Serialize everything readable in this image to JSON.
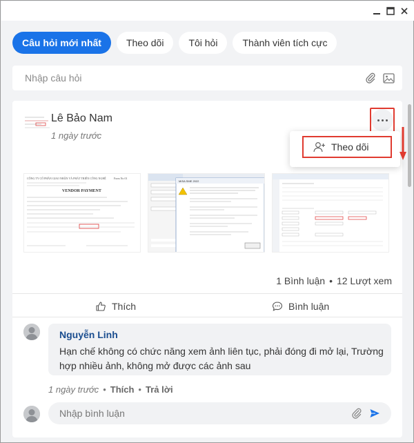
{
  "tabs": [
    {
      "label": "Câu hỏi mới nhất",
      "active": true
    },
    {
      "label": "Theo dõi",
      "active": false
    },
    {
      "label": "Tôi hỏi",
      "active": false
    },
    {
      "label": "Thành viên tích cực",
      "active": false
    }
  ],
  "ask": {
    "placeholder": "Nhập câu hỏi"
  },
  "post": {
    "author": "Lê Bảo Nam",
    "time": "1 ngày trước",
    "menu": {
      "follow_label": "Theo dõi"
    },
    "stats": {
      "comments": "1 Bình luận",
      "separator": "•",
      "views": "12 Lượt xem"
    },
    "actions": {
      "like": "Thích",
      "comment": "Bình luận"
    },
    "image1": {
      "header1": "CÔNG TY CỔ PHẦN GIAO NHẬN VÀ PHÁT TRIỂN CÔNG NGHỆ",
      "title": "VENDOR PAYMENT",
      "form_no": "Form No 01"
    },
    "image2": {
      "title": "MISA SME 2022"
    },
    "image3": {}
  },
  "comment": {
    "author": "Nguyễn Linh",
    "text": "Hạn chế không có chức năng xem ảnh liên tục, phải đóng đi mở lại, Trường hợp nhiều ảnh, không mở được các ảnh sau",
    "time": "1 ngày trước",
    "separator": "•",
    "like": "Thích",
    "reply": "Trả lời"
  },
  "reply_box": {
    "placeholder": "Nhập bình luận"
  },
  "colors": {
    "accent": "#1a73e8",
    "highlight": "#e03a2f",
    "background": "#f2f3f5"
  }
}
